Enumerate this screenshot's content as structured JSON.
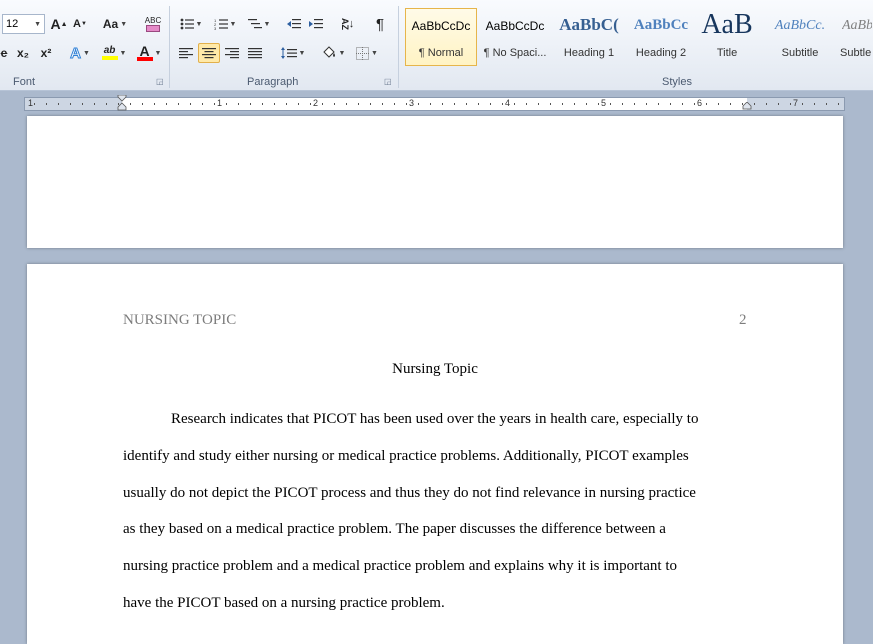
{
  "ribbon": {
    "font": {
      "label": "Font",
      "size": "12",
      "grow": "A",
      "shrink": "A",
      "change_case": "Aa",
      "subscript": "x₂",
      "superscript": "x²",
      "clear_format": "ABC",
      "text_effects": "A",
      "highlight": "ab",
      "font_color": "A"
    },
    "paragraph": {
      "label": "Paragraph",
      "sort": "AZ",
      "pilcrow": "¶"
    },
    "styles": {
      "label": "Styles",
      "items": [
        {
          "preview": "AaBbCcDc",
          "name": "¶ Normal"
        },
        {
          "preview": "AaBbCcDc",
          "name": "¶ No Spaci..."
        },
        {
          "preview": "AaBbC(",
          "name": "Heading 1"
        },
        {
          "preview": "AaBbCc",
          "name": "Heading 2"
        },
        {
          "preview": "AaB",
          "name": "Title"
        },
        {
          "preview": "AaBbCc.",
          "name": "Subtitle"
        },
        {
          "preview": "AaBb",
          "name": "Subtle"
        }
      ]
    },
    "colors": {
      "highlight": "#ffff00",
      "font_color": "#ff0000"
    }
  },
  "ruler": {
    "numbers": [
      "1",
      "1",
      "2",
      "3",
      "4",
      "5",
      "6",
      "7"
    ]
  },
  "document": {
    "running_head": "NURSING TOPIC",
    "page_number": "2",
    "title": "Nursing Topic",
    "lines": [
      "Research indicates that PICOT has been used over the years in health care, especially to",
      "identify and study either nursing or medical practice problems. Additionally, PICOT examples",
      "usually do not depict the PICOT process and thus they do not find relevance in nursing practice",
      "as they based on a medical practice problem. The paper discusses the difference between a",
      "nursing practice problem and a medical practice problem and explains why it is important to",
      "have the PICOT based on a nursing practice problem."
    ]
  }
}
